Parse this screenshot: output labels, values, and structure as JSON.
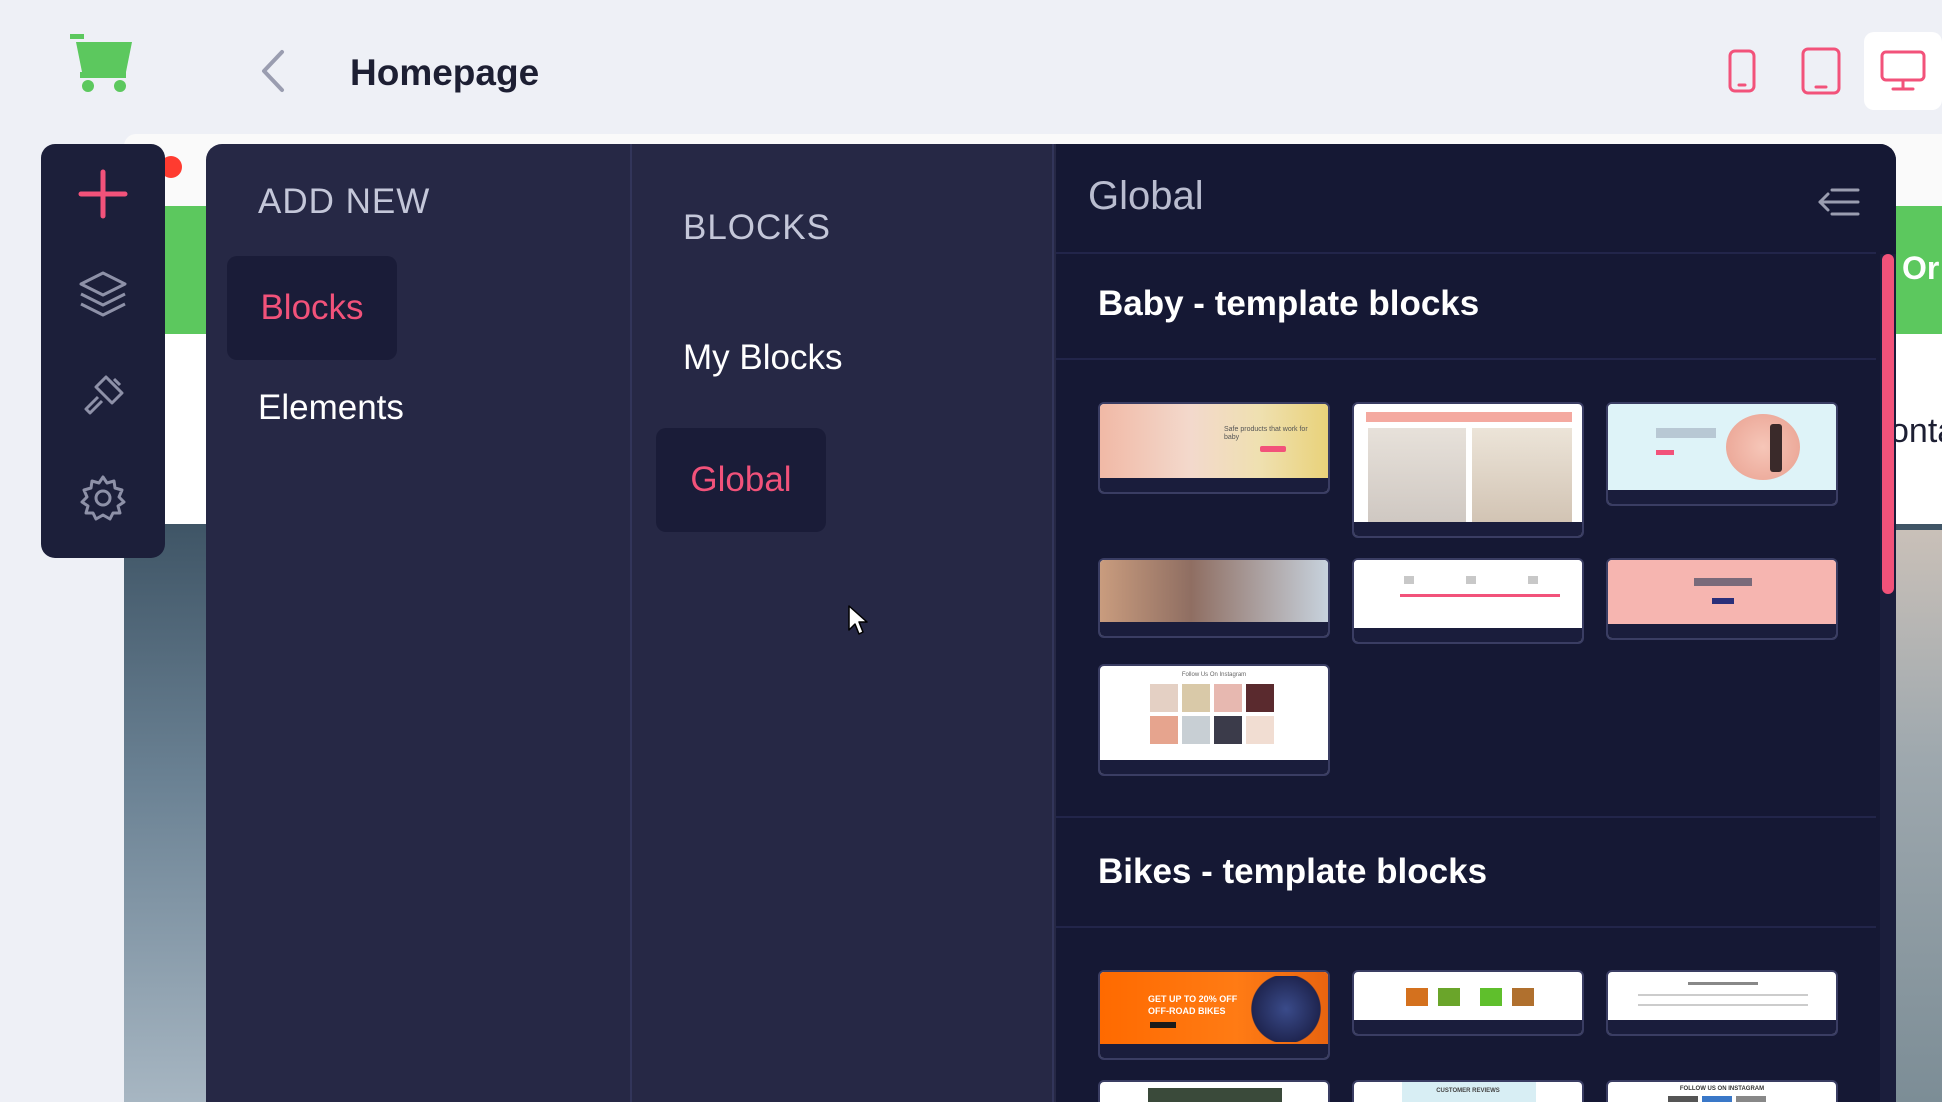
{
  "header": {
    "page_title": "Homepage",
    "devices": [
      "mobile",
      "tablet",
      "desktop"
    ],
    "active_device": "desktop"
  },
  "preview_peek": {
    "green_text": "Or",
    "dark_text": "onta"
  },
  "rail": {
    "items": [
      "plus-icon",
      "layers-icon",
      "brush-icon",
      "gear-icon"
    ]
  },
  "add_new": {
    "heading": "ADD NEW",
    "items": [
      {
        "label": "Blocks",
        "active": true
      },
      {
        "label": "Elements",
        "active": false
      }
    ]
  },
  "blocks": {
    "heading": "BLOCKS",
    "items": [
      {
        "label": "My Blocks",
        "active": false
      },
      {
        "label": "Global",
        "active": true
      }
    ]
  },
  "global": {
    "title": "Global",
    "sections": [
      {
        "title": "Baby - template blocks"
      },
      {
        "title": "Bikes - template blocks"
      }
    ],
    "thumbnail_texts": {
      "baby_hero": "Safe products that work for baby",
      "baby_instagram": "Follow Us On Instagram",
      "bikes_hero_line1": "GET UP TO 20% OFF",
      "bikes_hero_line2": "OFF-ROAD BIKES",
      "bikes_reviews": "CUSTOMER REVIEWS",
      "bikes_instagram": "FOLLOW US ON INSTAGRAM"
    }
  },
  "colors": {
    "accent": "#f2527a",
    "panel": "#262845",
    "panel_dark": "#151834",
    "rail": "#1c1f3a",
    "brand_green": "#5cc85e"
  }
}
